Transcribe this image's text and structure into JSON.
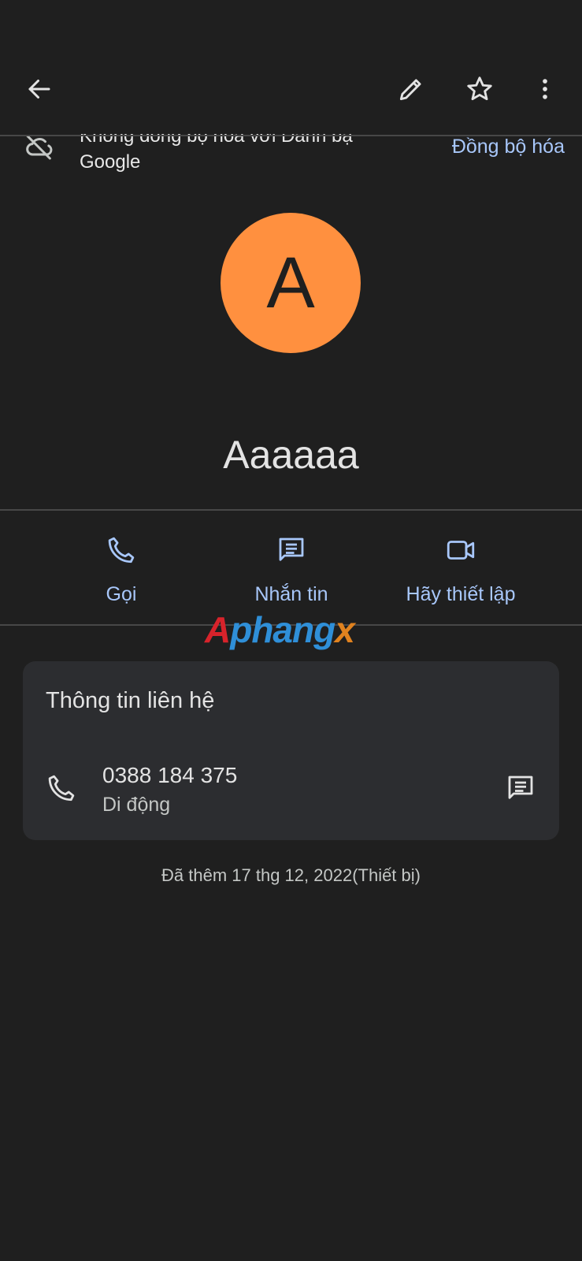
{
  "sync_banner": {
    "text": "Không đồng bộ hóa với Danh bạ Google",
    "action": "Đồng bộ hóa"
  },
  "contact": {
    "initial": "A",
    "name": "Aaaaaa",
    "avatar_color": "#ff903f"
  },
  "actions": [
    {
      "label": "Gọi",
      "icon": "phone-icon"
    },
    {
      "label": "Nhắn tin",
      "icon": "message-icon"
    },
    {
      "label": "Hãy thiết lập",
      "icon": "video-icon"
    }
  ],
  "watermark": {
    "first": "A",
    "rest": "phang",
    "last": "x"
  },
  "contact_info": {
    "title": "Thông tin liên hệ",
    "phone": {
      "number": "0388 184 375",
      "type": "Di động"
    }
  },
  "footer": {
    "added": "Đã thêm 17 thg 12, 2022(Thiết bị)"
  },
  "colors": {
    "accent": "#a8c7fa",
    "background": "#1f1f1f",
    "card": "#2c2d30"
  }
}
